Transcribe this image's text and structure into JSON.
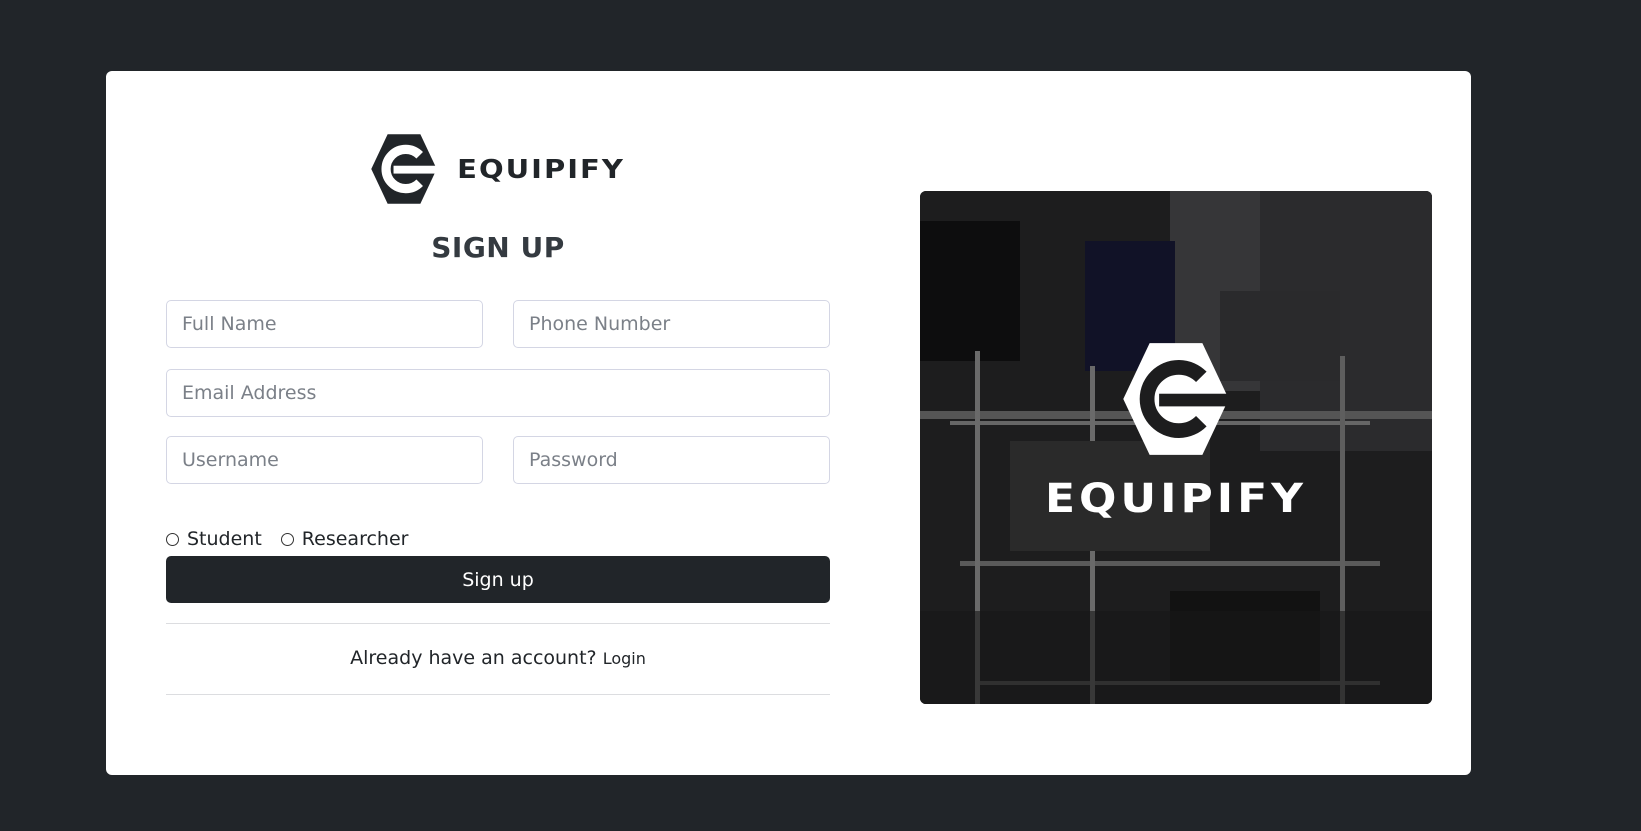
{
  "brand": {
    "name": "EQUIPIFY",
    "logo_icon": "equipify-wrench-e-logo"
  },
  "form": {
    "title": "SIGN UP",
    "fields": {
      "full_name": {
        "placeholder": "Full Name",
        "value": ""
      },
      "phone": {
        "placeholder": "Phone Number",
        "value": ""
      },
      "email": {
        "placeholder": "Email Address",
        "value": ""
      },
      "username": {
        "placeholder": "Username",
        "value": ""
      },
      "password": {
        "placeholder": "Password",
        "value": ""
      }
    },
    "roles": [
      {
        "label": "Student",
        "selected": false
      },
      {
        "label": "Researcher",
        "selected": false
      }
    ],
    "submit_label": "Sign up",
    "login_prompt": "Already have an account?",
    "login_link": "Login"
  },
  "hero": {
    "brand_name": "EQUIPIFY",
    "image_icon": "office-equipment-photo"
  },
  "colors": {
    "page_background": "#212529",
    "card_background": "#ffffff",
    "primary": "#212529",
    "input_border": "#d4d6e4"
  }
}
